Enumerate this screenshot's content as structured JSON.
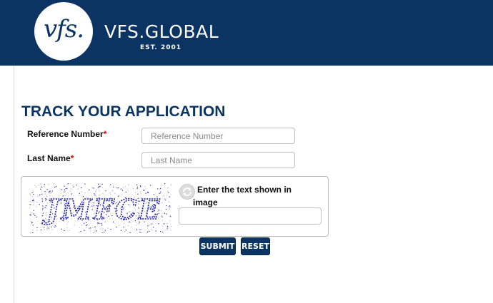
{
  "header": {
    "logo_mark": "vfs.",
    "brand": "VFS.GLOBAL",
    "established": "EST. 2001"
  },
  "page_title": "TRACK YOUR APPLICATION",
  "form": {
    "reference_label": "Reference Number",
    "reference_placeholder": "Reference Number",
    "reference_value": "",
    "lastname_label": "Last Name",
    "lastname_placeholder": "Last Name",
    "lastname_value": "",
    "required_marker": "*"
  },
  "captcha": {
    "image_text": "JMFCE",
    "instruction_line1": "Enter the text shown in",
    "instruction_line2": "image",
    "value": "",
    "refresh_icon": "refresh-icon"
  },
  "buttons": {
    "submit": "SUBMIT",
    "reset": "RESET"
  },
  "colors": {
    "brand": "#0b3463",
    "required": "#cc0000",
    "captcha_ink": "#1a1aa8"
  }
}
